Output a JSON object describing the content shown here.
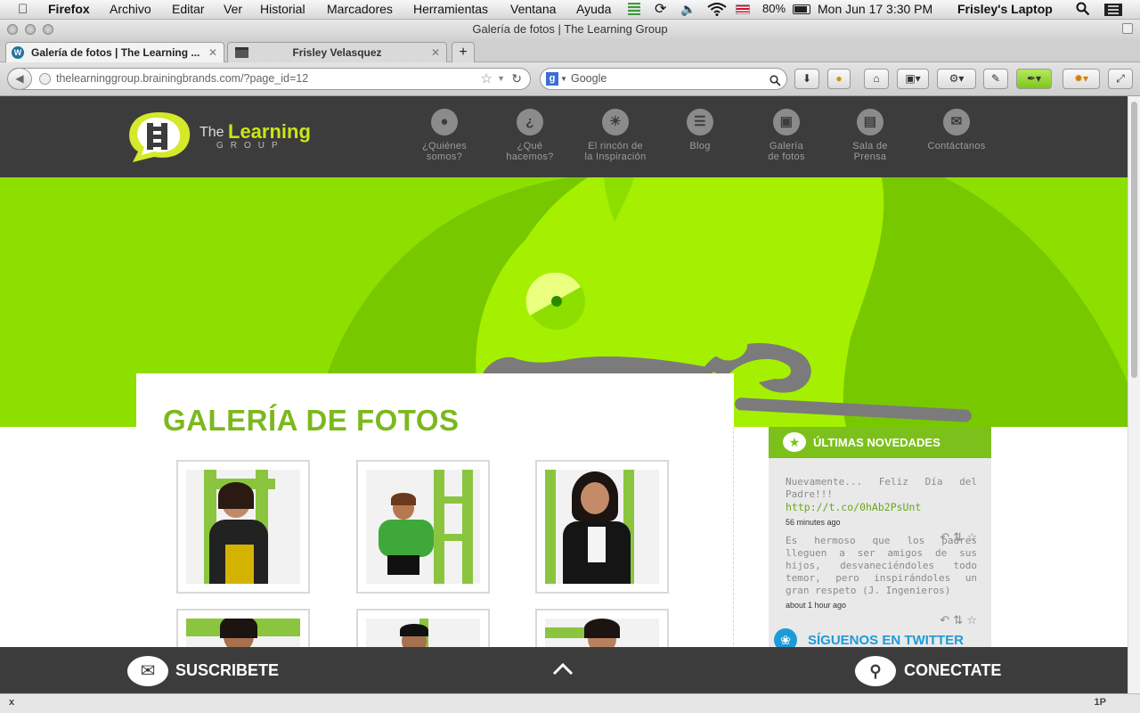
{
  "os_menu": {
    "apple": "",
    "app": "Firefox",
    "items": [
      "Archivo",
      "Editar",
      "Ver",
      "Historial",
      "Marcadores",
      "Herramientas",
      "Ventana",
      "Ayuda"
    ],
    "battery": "80%",
    "datetime": "Mon Jun 17  3:30 PM",
    "computer": "Frisley's Laptop"
  },
  "window": {
    "title": "Galería de fotos | The Learning Group"
  },
  "tabs": [
    {
      "label": "Galería de fotos | The Learning ..."
    },
    {
      "label": "Frisley Velasquez"
    }
  ],
  "new_tab": "+",
  "url": {
    "value": "thelearninggroup.brainingbrands.com/?page_id=12"
  },
  "search": {
    "placeholder": "Google"
  },
  "site": {
    "logo_the": "The",
    "logo_learning": "Learning",
    "logo_group": "GROUP",
    "nav": [
      {
        "line1": "¿Quiénes",
        "line2": "somos?",
        "icon": "user-icon"
      },
      {
        "line1": "¿Qué",
        "line2": "hacemos?",
        "icon": "question-icon"
      },
      {
        "line1": "El rincón de",
        "line2": "la Inspiración",
        "icon": "lightbulb-icon"
      },
      {
        "line1": "Blog",
        "line2": "",
        "icon": "document-icon"
      },
      {
        "line1": "Galería",
        "line2": "de fotos",
        "icon": "photo-icon"
      },
      {
        "line1": "Sala de",
        "line2": "Prensa",
        "icon": "press-icon"
      },
      {
        "line1": "Contáctanos",
        "line2": "",
        "icon": "mail-icon"
      }
    ],
    "page_title": "GALERÍA DE FOTOS",
    "sidebar_heading": "ÚLTIMAS NOVEDADES",
    "tweets": [
      {
        "text": "Nuevamente... Feliz Día del Padre!!!",
        "link": "http://t.co/0hAb2PsUnt",
        "time": "56 minutes ago"
      },
      {
        "text": "Es hermoso que los padres lleguen a ser amigos de sus hijos, desvaneciéndoles todo temor, pero inspirándoles un gran respeto (J. Ingenieros)",
        "link": "",
        "time": "about 1 hour ago"
      }
    ],
    "twitter_follow": "SÍGUENOS EN TWITTER",
    "subscribe": "SUSCRIBETE",
    "connect": "CONECTATE"
  },
  "status": {
    "left": "x",
    "right": "1P"
  },
  "colors": {
    "accent": "#8ddf00",
    "title_green": "#7cb81e",
    "dark": "#3c3c3c"
  }
}
